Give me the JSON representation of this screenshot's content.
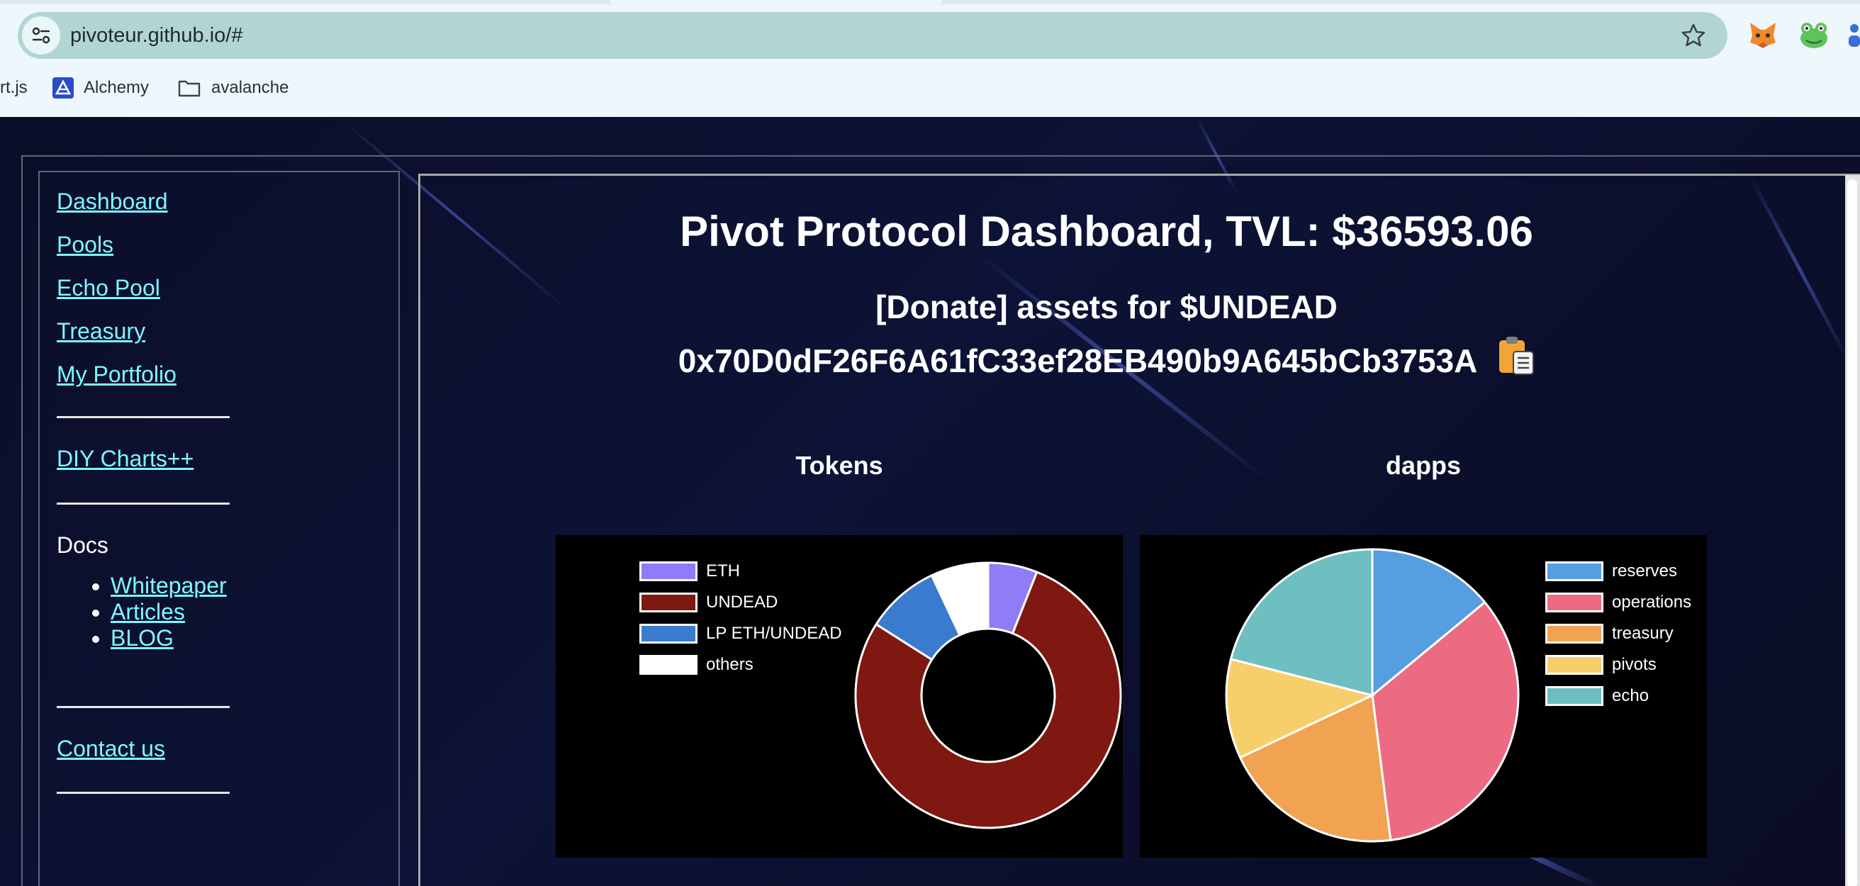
{
  "browser": {
    "url": "pivoteur.github.io/#",
    "bookmarks": [
      {
        "label": "rt.js",
        "icon": "chart-js-icon"
      },
      {
        "label": "Alchemy",
        "icon": "alchemy-logo-icon"
      },
      {
        "label": "avalanche",
        "icon": "folder-icon"
      }
    ]
  },
  "sidebar": {
    "nav": [
      {
        "label": "Dashboard"
      },
      {
        "label": "Pools"
      },
      {
        "label": "Echo Pool"
      },
      {
        "label": "Treasury"
      },
      {
        "label": "My Portfolio"
      }
    ],
    "diy_label": "DIY Charts++",
    "docs_label": "Docs",
    "docs_links": [
      {
        "label": "Whitepaper"
      },
      {
        "label": "Articles"
      },
      {
        "label": "BLOG"
      }
    ],
    "contact_label": "Contact us"
  },
  "main": {
    "title": "Pivot Protocol Dashboard, TVL: $36593.06",
    "donate_text": "[Donate] assets for $UNDEAD",
    "address": "0x70D0dF26F6A61fC33ef28EB490b9A645bCb3753A"
  },
  "colors": {
    "link": "#7df7ff",
    "eth": "#8f7cf7",
    "undead": "#7f1810",
    "lp": "#3a7bd0",
    "others": "#ffffff",
    "reserves": "#559ee0",
    "operations": "#ec6b83",
    "treasury": "#f1a352",
    "pivots": "#f7cf6a",
    "echo": "#6dbfc0"
  },
  "chart_data": [
    {
      "type": "doughnut",
      "title": "Tokens",
      "labels": [
        "ETH",
        "UNDEAD",
        "LP ETH/UNDEAD",
        "others"
      ],
      "values": [
        6,
        78,
        9,
        7
      ],
      "colors": [
        "#8f7cf7",
        "#7f1810",
        "#3a7bd0",
        "#ffffff"
      ],
      "legend": "left"
    },
    {
      "type": "pie",
      "title": "dapps",
      "labels": [
        "reserves",
        "operations",
        "treasury",
        "pivots",
        "echo"
      ],
      "values": [
        14,
        34,
        20,
        11,
        21
      ],
      "colors": [
        "#559ee0",
        "#ec6b83",
        "#f1a352",
        "#f7cf6a",
        "#6dbfc0"
      ],
      "legend": "right"
    }
  ]
}
